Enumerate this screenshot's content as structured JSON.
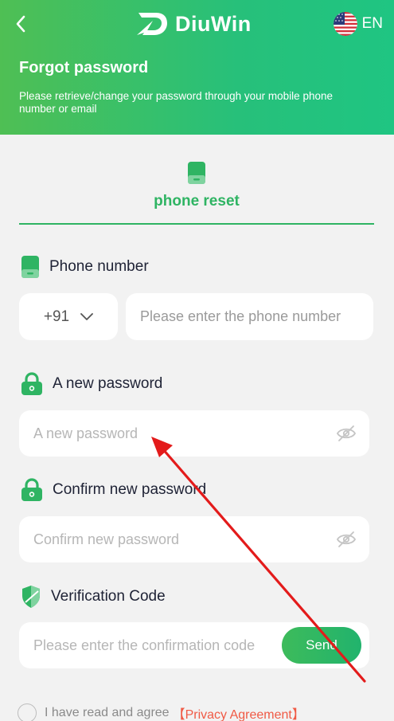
{
  "header": {
    "brand": "DiuWin",
    "language": "EN",
    "title": "Forgot password",
    "subtitle": "Please retrieve/change your password through your mobile phone number or email",
    "colors": {
      "gradient_start": "#4fbf54",
      "gradient_end": "#1fc582"
    }
  },
  "icons": {
    "back": "chevron-left-icon",
    "logo": "diuwin-logo-icon",
    "flag": "us-flag-icon",
    "phone": "phone-icon",
    "lock": "lock-icon",
    "shield": "shield-icon",
    "eye": "eye-off-icon",
    "dropdown": "chevron-down-icon"
  },
  "tab": {
    "label": "phone reset"
  },
  "phone": {
    "label": "Phone number",
    "country_code": "+91",
    "placeholder": "Please enter the phone number"
  },
  "new_password": {
    "label": "A new password",
    "placeholder": "A new password"
  },
  "confirm_password": {
    "label": "Confirm new password",
    "placeholder": "Confirm new password"
  },
  "verification": {
    "label": "Verification Code",
    "placeholder": "Please enter the confirmation code",
    "send_label": "Send"
  },
  "agreement": {
    "text": "I have read and agree",
    "link": "【Privacy Agreement】"
  },
  "accent_color": "#2fb463",
  "link_color": "#f05a45",
  "annotation_color": "#e31b1b"
}
